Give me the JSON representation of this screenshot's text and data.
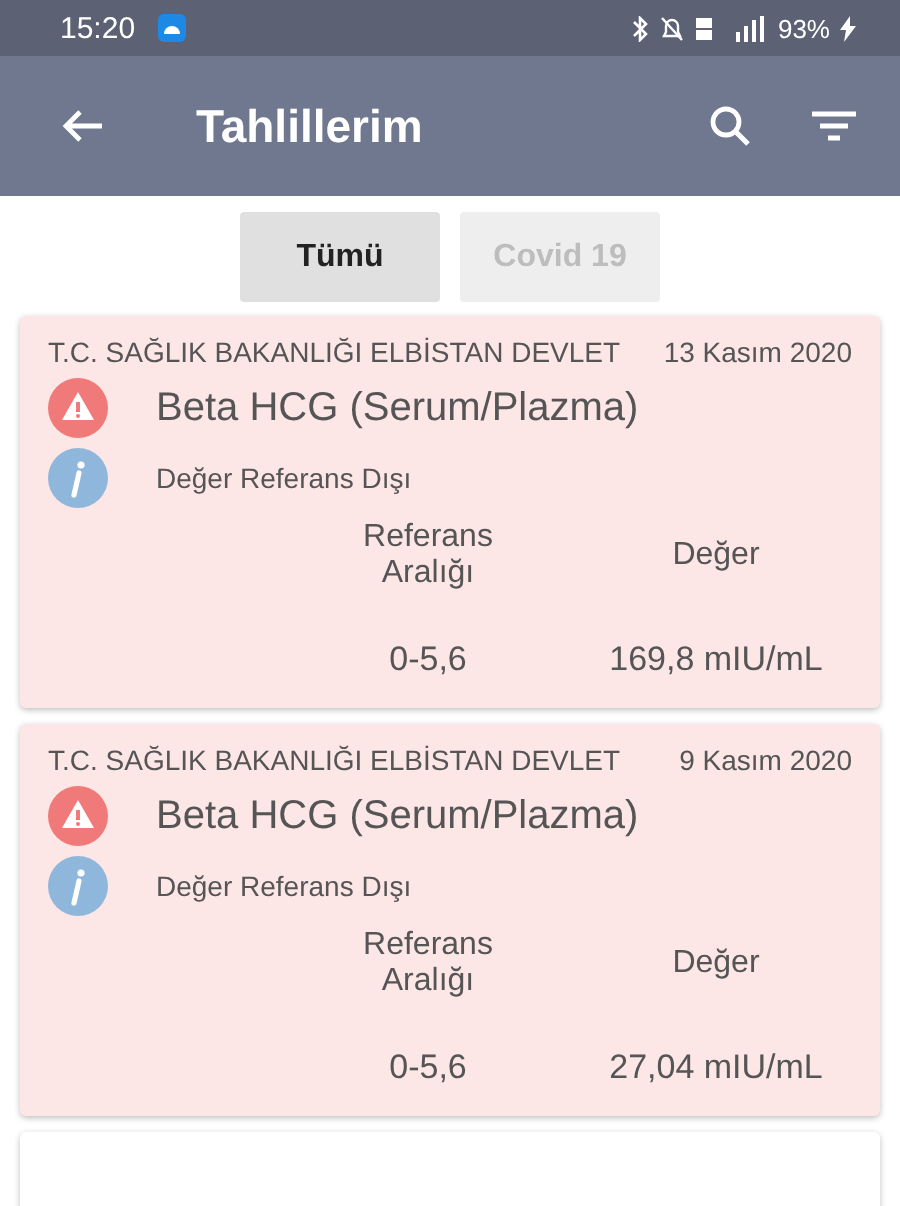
{
  "status_bar": {
    "time": "15:20",
    "battery": "93%"
  },
  "app_bar": {
    "title": "Tahlillerim"
  },
  "tabs": [
    {
      "label": "Tümü",
      "selected": true
    },
    {
      "label": "Covid 19",
      "selected": false
    }
  ],
  "results": [
    {
      "institution": "T.C. SAĞLIK BAKANLIĞI ELBİSTAN DEVLET",
      "date": "13 Kasım 2020",
      "test": "Beta HCG (Serum/Plazma)",
      "note": "Değer Referans Dışı",
      "out_of_range": true,
      "ref_header": "Referans Aralığı",
      "value_header": "Değer",
      "ref_range": "0-5,6",
      "value": "169,8 mIU/mL"
    },
    {
      "institution": "T.C. SAĞLIK BAKANLIĞI ELBİSTAN DEVLET",
      "date": "9 Kasım 2020",
      "test": "Beta HCG (Serum/Plazma)",
      "note": "Değer Referans Dışı",
      "out_of_range": true,
      "ref_header": "Referans Aralığı",
      "value_header": "Değer",
      "ref_range": "0-5,6",
      "value": "27,04 mIU/mL"
    }
  ]
}
